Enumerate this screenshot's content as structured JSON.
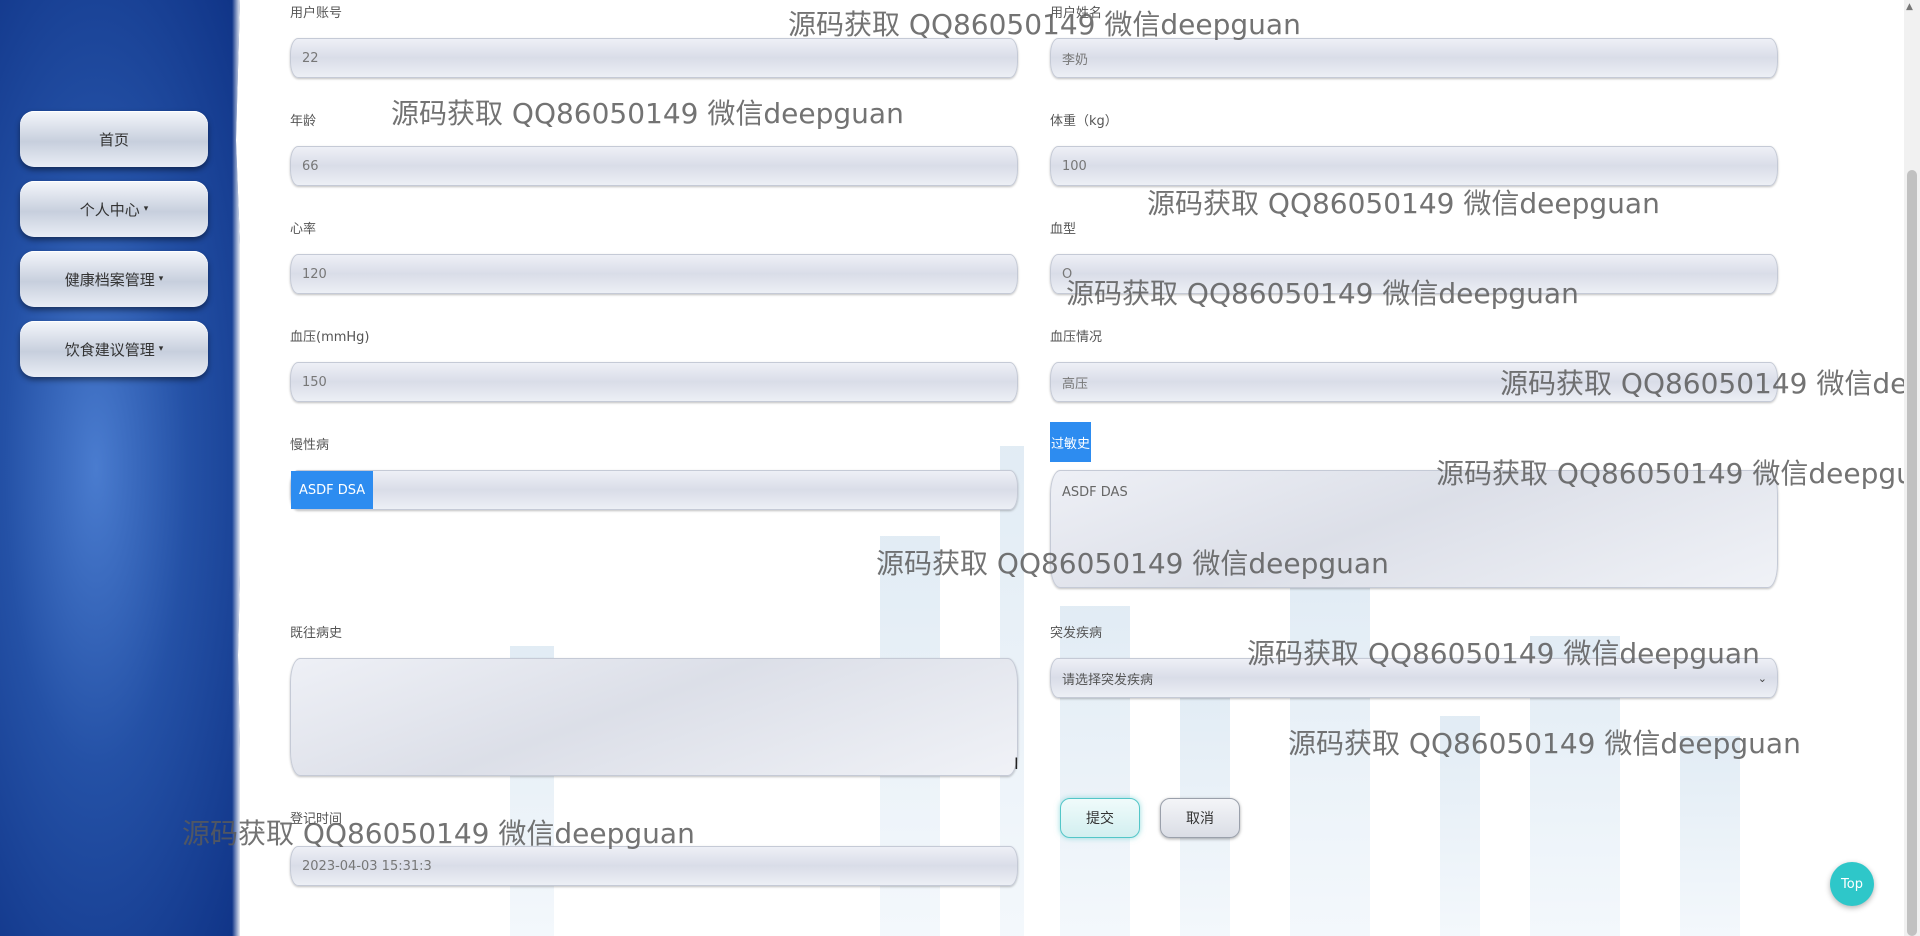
{
  "sidebar": {
    "items": [
      {
        "label": "首页",
        "has_caret": false
      },
      {
        "label": "个人中心",
        "has_caret": true
      },
      {
        "label": "健康档案管理",
        "has_caret": true
      },
      {
        "label": "饮食建议管理",
        "has_caret": true
      }
    ],
    "caret": "▾"
  },
  "form": {
    "account": {
      "label": "用户账号",
      "value": "22"
    },
    "name": {
      "label": "用户姓名",
      "value": "李奶"
    },
    "age": {
      "label": "年龄",
      "value": "66"
    },
    "weight": {
      "label": "体重（kg）",
      "value": "100"
    },
    "heart_rate": {
      "label": "心率",
      "value": "120"
    },
    "blood_type": {
      "label": "血型",
      "value": "O"
    },
    "blood_pressure": {
      "label": "血压(mmHg)",
      "value": "150"
    },
    "bp_status": {
      "label": "血压情况",
      "value": "高压"
    },
    "chronic": {
      "label": "慢性病",
      "value": "ASDF DSA"
    },
    "allergy": {
      "label": "过敏史",
      "value": "ASDF DAS"
    },
    "history": {
      "label": "既往病史",
      "value": ""
    },
    "sudden": {
      "label": "突发疾病",
      "placeholder": "请选择突发疾病"
    },
    "register_time": {
      "label": "登记时间",
      "value": "2023-04-03 15:31:3"
    }
  },
  "buttons": {
    "submit": "提交",
    "cancel": "取消",
    "top": "Top"
  },
  "watermark": "源码获取 QQ86050149 微信deepguan",
  "colors": {
    "sidebar": "#2451a6",
    "accent_blue": "#2d8cf0",
    "teal": "#2ec7c9"
  }
}
